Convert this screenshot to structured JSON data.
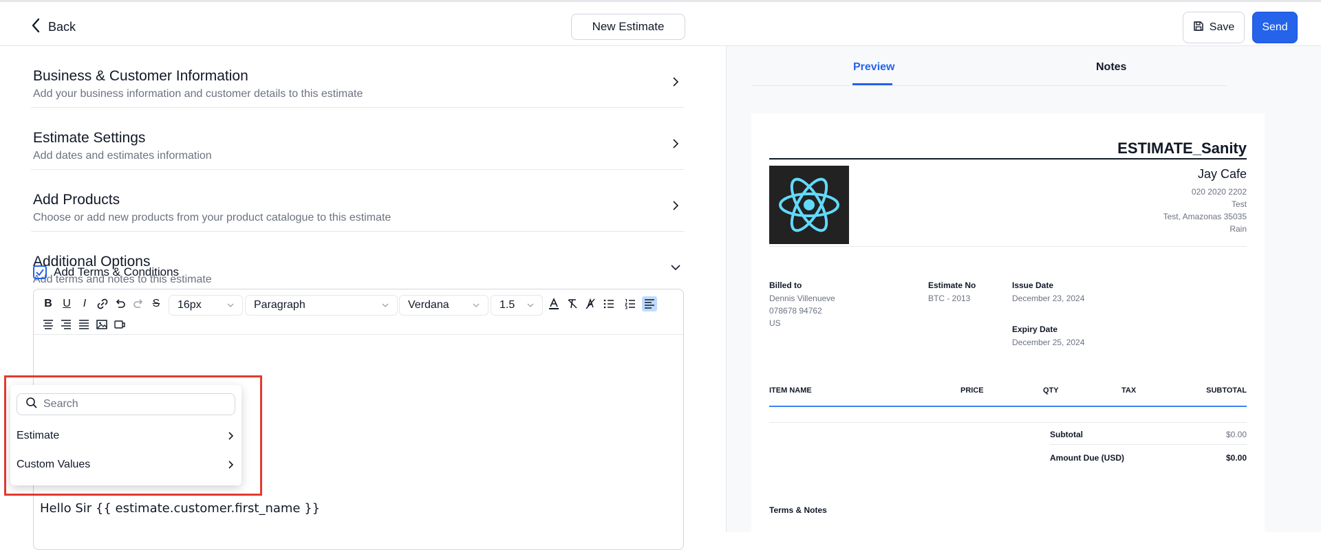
{
  "header": {
    "back_label": "Back",
    "doc_title": "New Estimate",
    "save_label": "Save",
    "send_label": "Send"
  },
  "sections": [
    {
      "title": "Business & Customer Information",
      "subtitle": "Add your business information and customer details to this estimate"
    },
    {
      "title": "Estimate Settings",
      "subtitle": "Add dates and estimates information"
    },
    {
      "title": "Add Products",
      "subtitle": "Choose or add new products from your product catalogue to this estimate"
    },
    {
      "title": "Additional Options",
      "subtitle": "Add terms and notes to this estimate"
    }
  ],
  "terms_checkbox": {
    "label": "Add Terms & Conditions",
    "checked": true
  },
  "toolbar": {
    "font_size": "16px",
    "block_type": "Paragraph",
    "font_family": "Verdana",
    "line_height": "1.5"
  },
  "editor": {
    "content": "Hello Sir {{ estimate.customer.first_name }}"
  },
  "popup": {
    "search_placeholder": "Search",
    "items": [
      "Estimate",
      "Custom Values"
    ]
  },
  "tabs": {
    "preview": "Preview",
    "notes": "Notes"
  },
  "preview": {
    "estimate_title": "ESTIMATE_Sanity",
    "business": {
      "name": "Jay Cafe",
      "phone": "020 2020 2202",
      "line1": "Test",
      "line2": "Test, Amazonas 35035",
      "line3": "Rain"
    },
    "billed_to_label": "Billed to",
    "billed_to": {
      "name": "Dennis Villenueve",
      "phone": "078678 94762",
      "country": "US"
    },
    "estimate_no_label": "Estimate No",
    "estimate_no": "BTC - 2013",
    "issue_date_label": "Issue Date",
    "issue_date": "December 23, 2024",
    "expiry_date_label": "Expiry Date",
    "expiry_date": "December 25, 2024",
    "table_headers": [
      "ITEM NAME",
      "PRICE",
      "QTY",
      "TAX",
      "SUBTOTAL"
    ],
    "subtotal_label": "Subtotal",
    "subtotal_value": "$0.00",
    "amount_due_label": "Amount Due (USD)",
    "amount_due_value": "$0.00",
    "terms_label": "Terms & Notes"
  },
  "colors": {
    "accent": "#2563eb",
    "highlight": "#e43a2e",
    "logo_bg": "#222222",
    "react_logo": "#61dafb"
  }
}
